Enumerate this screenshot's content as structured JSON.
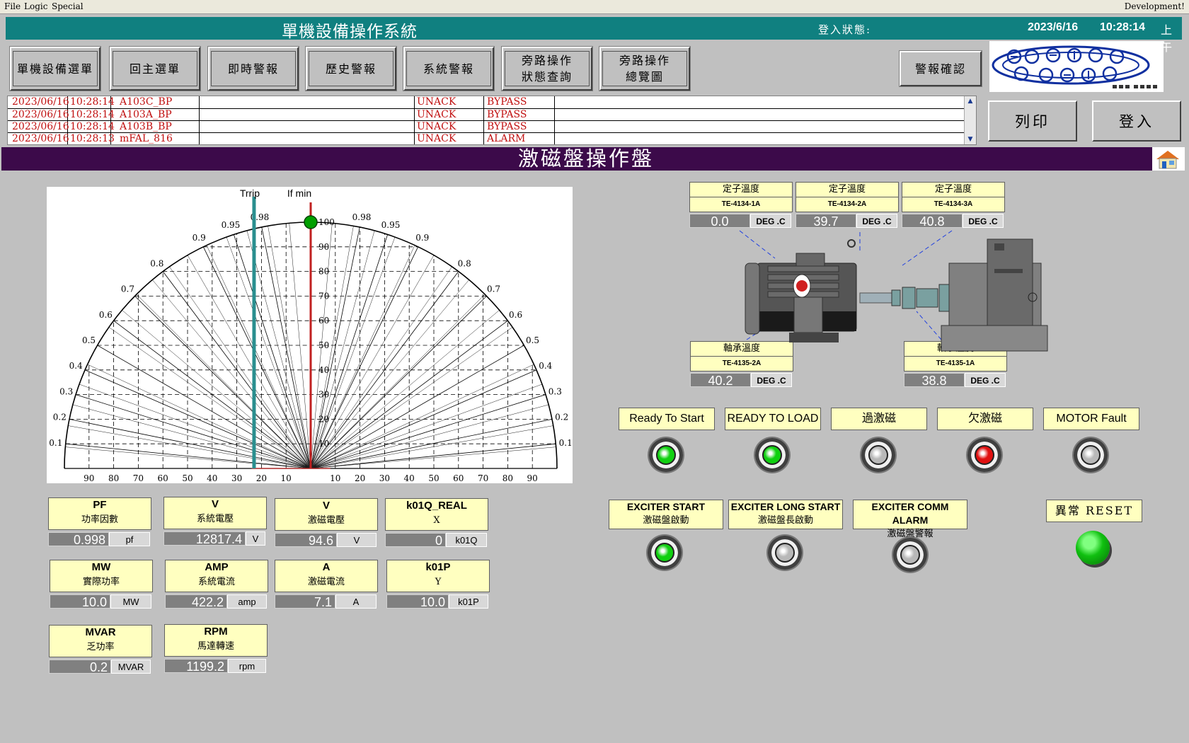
{
  "menu": {
    "file": "File",
    "logic": "Logic",
    "special": "Special",
    "right": "Development!"
  },
  "header": {
    "title": "單機設備操作系統",
    "login_label": "登入狀態:",
    "date": "2023/6/16",
    "time": "10:28:14",
    "ampm": "上午"
  },
  "nav": [
    "單機設備選單",
    "回主選單",
    "即時警報",
    "歷史警報",
    "系統警報",
    "旁路操作\n狀態查詢",
    "旁路操作\n總覽圖"
  ],
  "alarm_ack": "警報確認",
  "alarms": [
    {
      "date": "2023/06/16",
      "time": "10:28:14",
      "tag": "A103C_BP",
      "ack": "UNACK",
      "type": "BYPASS"
    },
    {
      "date": "2023/06/16",
      "time": "10:28:14",
      "tag": "A103A_BP",
      "ack": "UNACK",
      "type": "BYPASS"
    },
    {
      "date": "2023/06/16",
      "time": "10:28:14",
      "tag": "A103B_BP",
      "ack": "UNACK",
      "type": "BYPASS"
    },
    {
      "date": "2023/06/16",
      "time": "10:28:13",
      "tag": "mFAL_816",
      "ack": "UNACK",
      "type": "ALARM"
    }
  ],
  "print_btn": "列印",
  "login_btn": "登入",
  "panel_title": "激磁盤操作盤",
  "chart_data": {
    "type": "other",
    "title": "",
    "trip_label": "Trrip",
    "ifmin_label": "If min",
    "x_ticks_left": [
      "90",
      "80",
      "70",
      "60",
      "50",
      "40",
      "30",
      "20",
      "10"
    ],
    "x_ticks_right": [
      "10",
      "20",
      "30",
      "40",
      "50",
      "60",
      "70",
      "80",
      "90"
    ],
    "y_ticks": [
      "10",
      "20",
      "30",
      "40",
      "50",
      "60",
      "70",
      "80",
      "90",
      "100"
    ],
    "pf_labels_left": [
      "0.1",
      "0.2",
      "0.3",
      "0.4",
      "0.5",
      "0.6",
      "0.7",
      "0.8",
      "0.9",
      "0.95",
      "0.98"
    ],
    "pf_labels_right": [
      "0.98",
      "0.95",
      "0.9",
      "0.8",
      "0.7",
      "0.6",
      "0.5",
      "0.4",
      "0.3",
      "0.2",
      "0.1"
    ],
    "operating_point": {
      "x": 0,
      "y": 100
    },
    "colors": {
      "trip": "#2a8f8f",
      "ifmin": "#c02020",
      "point": "#00a000"
    }
  },
  "measurements": [
    {
      "title": "PF",
      "subtitle": "功率因數",
      "value": "0.998",
      "unit": "pf"
    },
    {
      "title": "V",
      "subtitle": "系統電壓",
      "value": "12817.4",
      "unit": "V"
    },
    {
      "title": "V",
      "subtitle": "激磁電壓",
      "value": "94.6",
      "unit": "V"
    },
    {
      "title": "k01Q_REAL",
      "subtitle": "X",
      "value": "0",
      "unit": "k01Q"
    },
    {
      "title": "MW",
      "subtitle": "實際功率",
      "value": "10.0",
      "unit": "MW"
    },
    {
      "title": "AMP",
      "subtitle": "系統電流",
      "value": "422.2",
      "unit": "amp"
    },
    {
      "title": "A",
      "subtitle": "激磁電流",
      "value": "7.1",
      "unit": "A"
    },
    {
      "title": "k01P",
      "subtitle": "Y",
      "value": "10.0",
      "unit": "k01P"
    },
    {
      "title": "MVAR",
      "subtitle": "乏功率",
      "value": "0.2",
      "unit": "MVAR"
    },
    {
      "title": "RPM",
      "subtitle": "馬達轉速",
      "value": "1199.2",
      "unit": "rpm"
    }
  ],
  "temps": [
    {
      "name": "定子溫度",
      "tag": "TE-4134-1A",
      "value": "0.0",
      "unit": "DEG .C"
    },
    {
      "name": "定子溫度",
      "tag": "TE-4134-2A",
      "value": "39.7",
      "unit": "DEG .C"
    },
    {
      "name": "定子溫度",
      "tag": "TE-4134-3A",
      "value": "40.8",
      "unit": "DEG .C"
    },
    {
      "name": "軸承溫度",
      "tag": "TE-4135-2A",
      "value": "40.2",
      "unit": "DEG .C"
    },
    {
      "name": "軸承溫度",
      "tag": "TE-4135-1A",
      "value": "38.8",
      "unit": "DEG .C"
    }
  ],
  "status_lamps": [
    {
      "label": "Ready To Start",
      "color": "#10d010"
    },
    {
      "label": "READY TO LOAD",
      "color": "#10d010"
    },
    {
      "label": "過激磁",
      "color": "#b8b8b8"
    },
    {
      "label": "欠激磁",
      "color": "#e01010"
    },
    {
      "label": "MOTOR Fault",
      "color": "#b8b8b8"
    }
  ],
  "exciter": [
    {
      "l1": "EXCITER START",
      "l2": "激磁盤啟動",
      "color": "#10d010"
    },
    {
      "l1": "EXCITER LONG START",
      "l2": "激磁盤長啟動",
      "color": "#b8b8b8"
    },
    {
      "l1": "EXCITER COMM ALARM",
      "l2": "激磁盤警報",
      "color": "#b8b8b8"
    }
  ],
  "reset_label": "異常 RESET"
}
